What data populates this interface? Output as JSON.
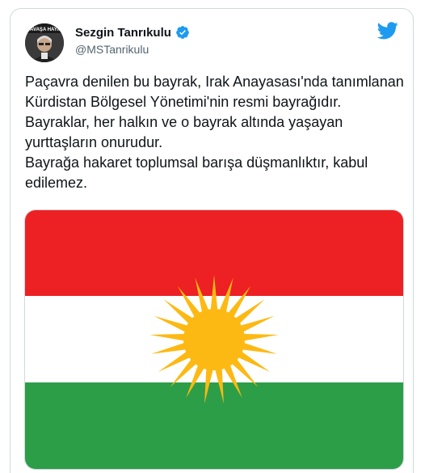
{
  "author": {
    "display_name": "Sezgin Tanrıkulu",
    "handle": "@MSTanrikulu",
    "verified_icon": "verified-badge-icon",
    "avatar_banner_text": "SAVAŞA HAYIR"
  },
  "platform_icon": "twitter-bird-icon",
  "tweet": {
    "paragraphs": [
      "Paçavra denilen bu bayrak, Irak Anayasası'nda tanımlanan Kürdistan Bölgesel Yönetimi'nin resmi bayrağıdır.",
      "Bayraklar, her halkın ve o bayrak altında yaşayan yurttaşların onurudur.",
      "Bayrağa hakaret toplumsal barışa düşmanlıktır, kabul edilemez."
    ]
  },
  "media": {
    "description_icon": "kurdistan-flag",
    "colors": {
      "red": "#ed2024",
      "white": "#ffffff",
      "green": "#2c9e48",
      "sun": "#fdb913"
    },
    "sun_rays": 21
  },
  "colors": {
    "accent": "#1d9bf0",
    "text": "#0f1419",
    "secondary": "#536471",
    "border": "#cfd9de"
  }
}
